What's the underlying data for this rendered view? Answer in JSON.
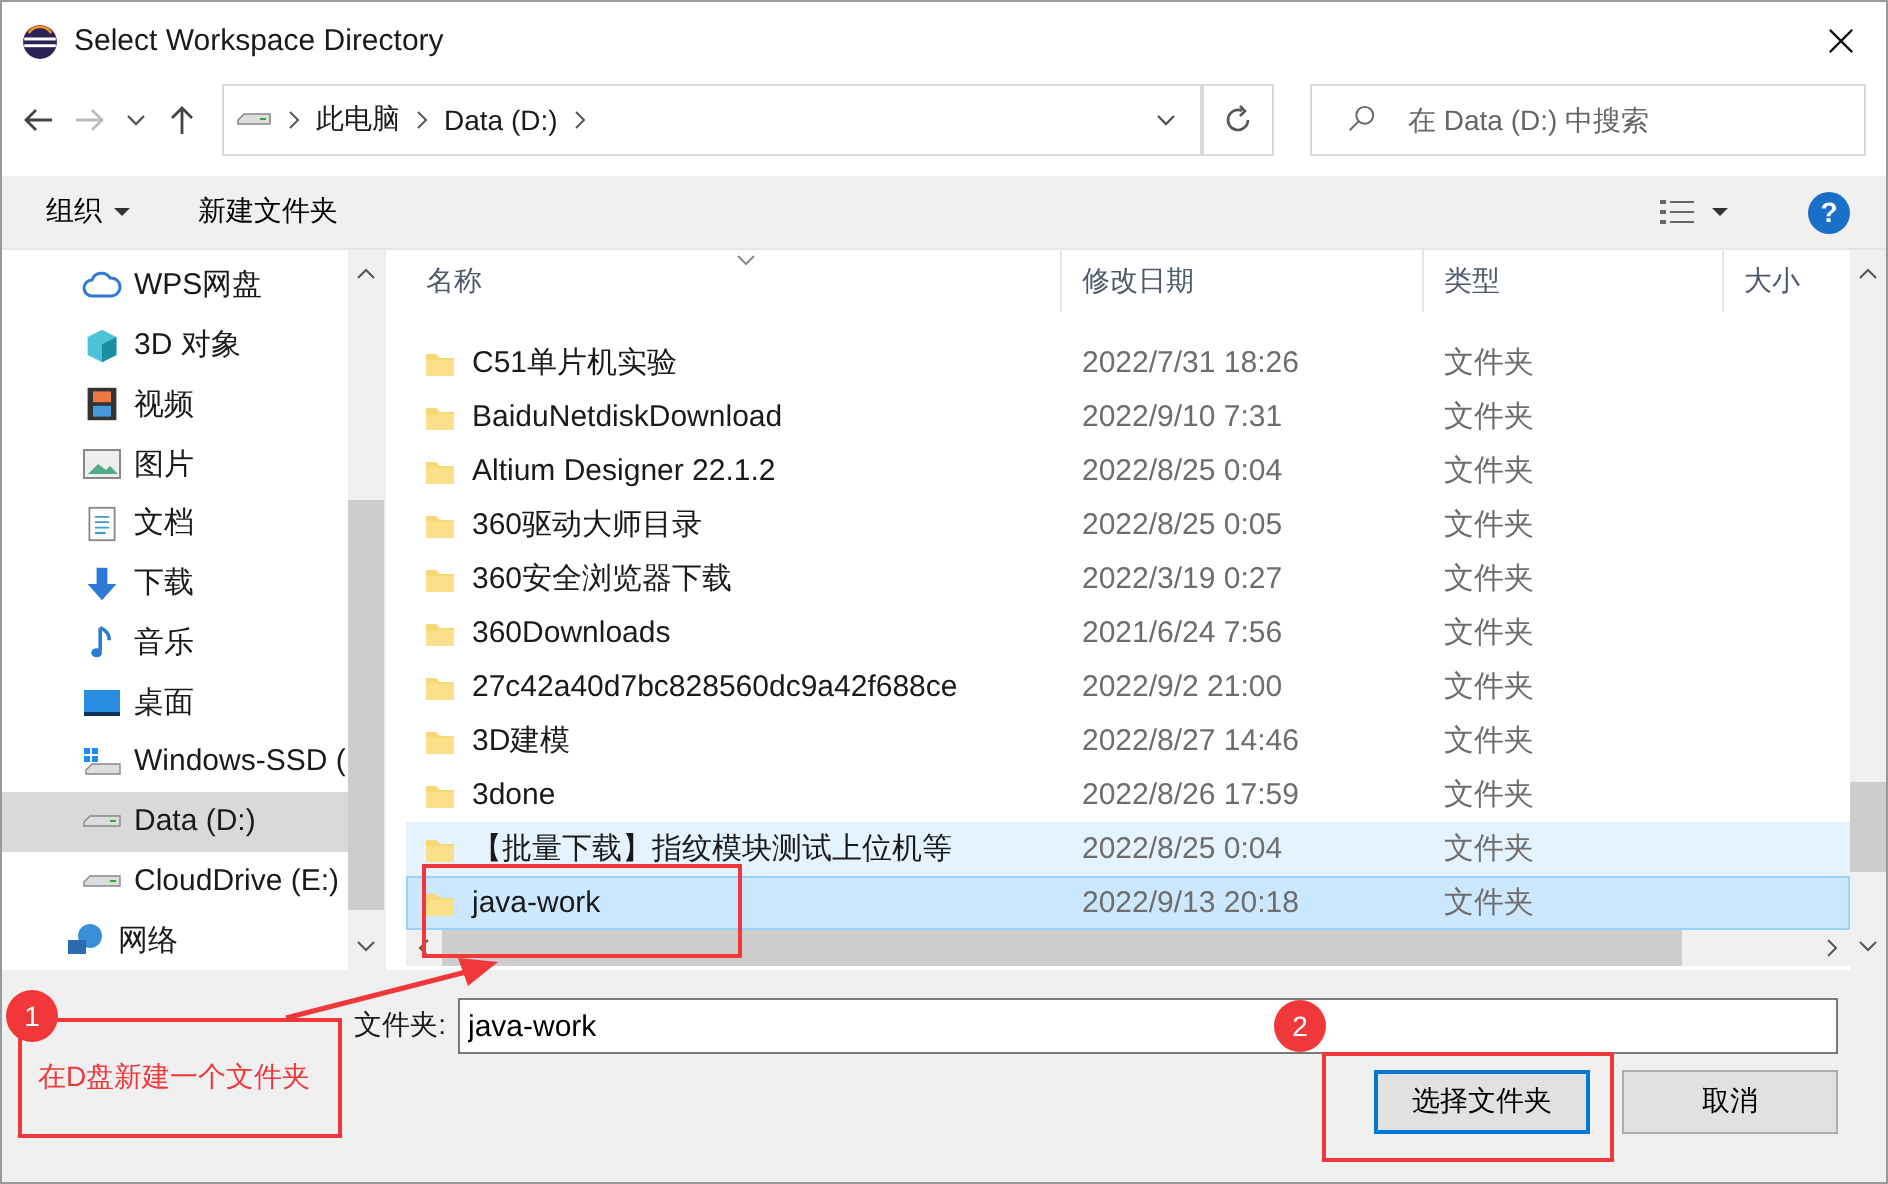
{
  "window": {
    "title": "Select Workspace Directory"
  },
  "address": {
    "crumbs": [
      "此电脑",
      "Data (D:)"
    ]
  },
  "search": {
    "placeholder": "在 Data (D:) 中搜索"
  },
  "toolbar": {
    "organize": "组织",
    "new_folder": "新建文件夹",
    "help": "?"
  },
  "sidebar": {
    "items": [
      {
        "label": "WPS网盘",
        "kind": "cloud",
        "selected": false
      },
      {
        "label": "3D 对象",
        "kind": "cube",
        "selected": false
      },
      {
        "label": "视频",
        "kind": "film",
        "selected": false
      },
      {
        "label": "图片",
        "kind": "picture",
        "selected": false
      },
      {
        "label": "文档",
        "kind": "document",
        "selected": false
      },
      {
        "label": "下载",
        "kind": "download",
        "selected": false
      },
      {
        "label": "音乐",
        "kind": "music",
        "selected": false
      },
      {
        "label": "桌面",
        "kind": "desktop",
        "selected": false
      },
      {
        "label": "Windows-SSD (",
        "kind": "windrive",
        "selected": false
      },
      {
        "label": "Data (D:)",
        "kind": "drive",
        "selected": true
      },
      {
        "label": "CloudDrive (E:)",
        "kind": "drive",
        "selected": false
      },
      {
        "label": "网络",
        "kind": "network",
        "selected": false
      }
    ]
  },
  "table": {
    "columns": [
      "名称",
      "修改日期",
      "类型",
      "大小"
    ],
    "rows": [
      {
        "name": "C51单片机实验",
        "date": "2022/7/31 18:26",
        "type": "文件夹",
        "selected": false,
        "hovered": false
      },
      {
        "name": "BaiduNetdiskDownload",
        "date": "2022/9/10 7:31",
        "type": "文件夹",
        "selected": false,
        "hovered": false
      },
      {
        "name": "Altium Designer 22.1.2",
        "date": "2022/8/25 0:04",
        "type": "文件夹",
        "selected": false,
        "hovered": false
      },
      {
        "name": "360驱动大师目录",
        "date": "2022/8/25 0:05",
        "type": "文件夹",
        "selected": false,
        "hovered": false
      },
      {
        "name": "360安全浏览器下载",
        "date": "2022/3/19 0:27",
        "type": "文件夹",
        "selected": false,
        "hovered": false
      },
      {
        "name": "360Downloads",
        "date": "2021/6/24 7:56",
        "type": "文件夹",
        "selected": false,
        "hovered": false
      },
      {
        "name": "27c42a40d7bc828560dc9a42f688ce",
        "date": "2022/9/2 21:00",
        "type": "文件夹",
        "selected": false,
        "hovered": false
      },
      {
        "name": "3D建模",
        "date": "2022/8/27 14:46",
        "type": "文件夹",
        "selected": false,
        "hovered": false
      },
      {
        "name": "3done",
        "date": "2022/8/26 17:59",
        "type": "文件夹",
        "selected": false,
        "hovered": false
      },
      {
        "name": "【批量下载】指纹模块测试上位机等",
        "date": "2022/8/25 0:04",
        "type": "文件夹",
        "selected": false,
        "hovered": true
      },
      {
        "name": "java-work",
        "date": "2022/9/13 20:18",
        "type": "文件夹",
        "selected": true,
        "hovered": false
      }
    ]
  },
  "folder_field": {
    "label": "文件夹:",
    "value": "java-work"
  },
  "buttons": [
    "选择文件夹",
    "取消"
  ],
  "annotations": {
    "badges": [
      "1",
      "2"
    ],
    "note": "在D盘新建一个文件夹"
  }
}
